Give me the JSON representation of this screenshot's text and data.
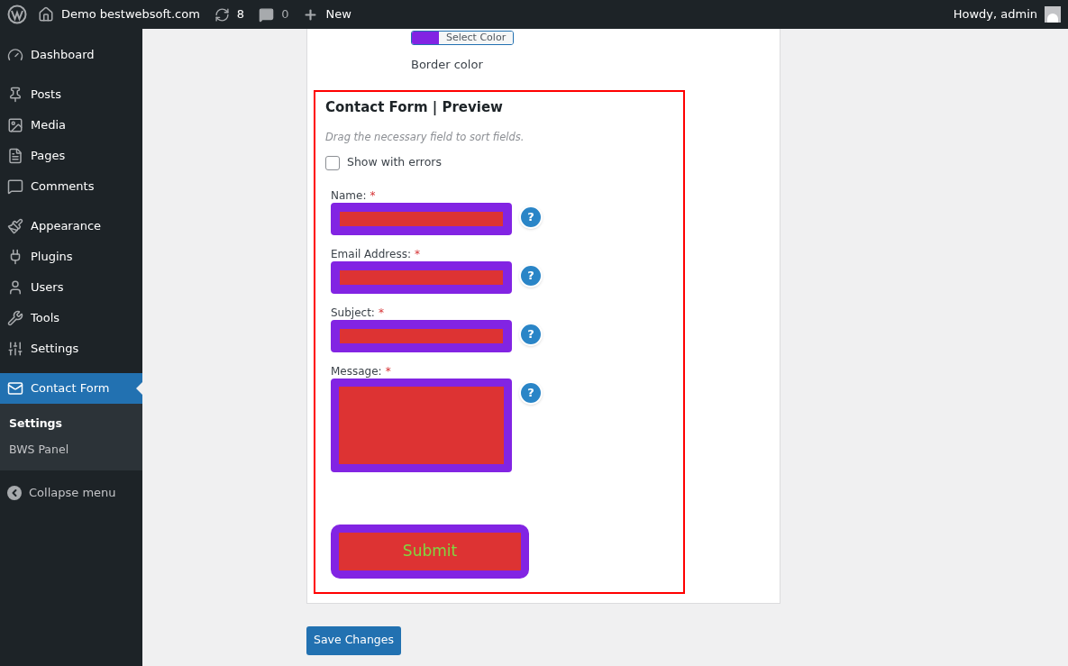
{
  "top_bar": {
    "site": "Demo bestwebsoft.com",
    "updates": "8",
    "comments": "0",
    "new": "New",
    "greeting": "Howdy, admin"
  },
  "sidebar": {
    "groups": [
      [
        {
          "label": "Dashboard",
          "selected": false
        }
      ],
      [
        {
          "label": "Posts",
          "selected": false
        },
        {
          "label": "Media",
          "selected": false
        },
        {
          "label": "Pages",
          "selected": false
        },
        {
          "label": "Comments",
          "selected": false
        }
      ],
      [
        {
          "label": "Appearance",
          "selected": false
        },
        {
          "label": "Plugins",
          "selected": false
        },
        {
          "label": "Users",
          "selected": false
        },
        {
          "label": "Tools",
          "selected": false
        },
        {
          "label": "Settings",
          "selected": false
        }
      ],
      [
        {
          "label": "Contact Form",
          "selected": true
        }
      ]
    ],
    "submenu": [
      {
        "label": "Settings",
        "selected": true
      },
      {
        "label": "BWS Panel",
        "selected": false
      }
    ],
    "collapse": "Collapse menu"
  },
  "color_setting": {
    "button": "Select Color",
    "color": "#8224e3",
    "label": "Border color"
  },
  "preview": {
    "title": "Contact Form | Preview",
    "hint": "Drag the necessary field to sort fields.",
    "show_errors": {
      "label": "Show with errors",
      "checked": false
    },
    "fields": [
      {
        "label": "Name:",
        "required": true,
        "kind": "input"
      },
      {
        "label": "Email Address:",
        "required": true,
        "kind": "input"
      },
      {
        "label": "Subject:",
        "required": true,
        "kind": "input"
      },
      {
        "label": "Message:",
        "required": true,
        "kind": "textarea"
      }
    ],
    "required_mark": "*",
    "help": "?",
    "submit": "Submit"
  },
  "save_button": "Save Changes"
}
